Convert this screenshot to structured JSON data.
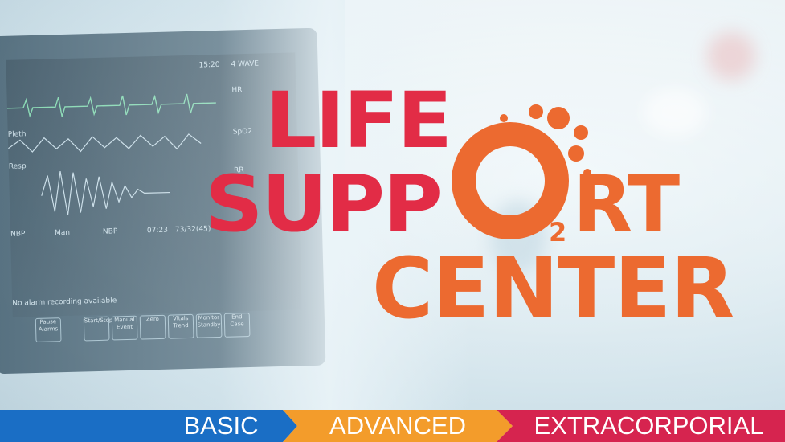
{
  "logo": {
    "line1": "LIFE",
    "line2_left": "SUPP",
    "line2_right": "RT",
    "line3": "CENTER",
    "o2_subscript": "2",
    "colors": {
      "red": "#e22c46",
      "orange": "#ec6a30"
    }
  },
  "monitor": {
    "time": "15:20",
    "wave_label": "4 WAVE",
    "pleth_label": "Pleth",
    "resp_label": "Resp",
    "nbp_label": "NBP",
    "man_label": "Man",
    "nbp_label_2": "NBP",
    "nbp_time": "07:23",
    "nbp_value": "73/32(45)",
    "hr_label": "HR",
    "spo2_label": "SpO2",
    "rr_label": "RR",
    "alarm_text": "No alarm recording available",
    "buttons": [
      "Pause Alarms",
      "Start/Stop",
      "Manual Event",
      "Zero",
      "Vitals Trend",
      "Monitor Standby",
      "End Case"
    ]
  },
  "bottom_bar": {
    "basic": "BASIC",
    "advanced": "ADVANCED",
    "extracorporial": "EXTRACORPORIAL",
    "colors": {
      "basic": "#1a6ec5",
      "advanced": "#f39c2b",
      "extracorporial": "#d6244f"
    }
  }
}
